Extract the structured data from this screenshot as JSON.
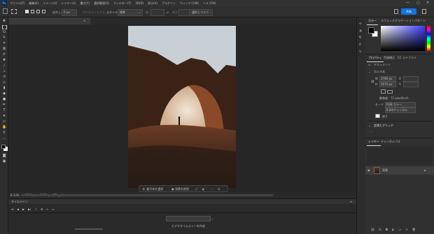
{
  "app": {
    "logo": "Ps",
    "menu": [
      "ファイル(F)",
      "編集(E)",
      "イメージ(I)",
      "レイヤー(L)",
      "書式(Y)",
      "選択範囲(S)",
      "フィルター(T)",
      "3D(D)",
      "表示(V)",
      "プラグイン",
      "ウィンドウ(W)",
      "ヘルプ(H)"
    ],
    "window_controls": [
      "—",
      "▢",
      "✕"
    ]
  },
  "options_bar": {
    "feather_label": "ぼかし:",
    "feather_value": "0 px",
    "antialias_label": "アンチエイリアス",
    "style_label": "スタイル:",
    "style_value": "標準",
    "width_label": "幅:",
    "height_label": "高さ:",
    "select_mask_button": "選択とマスク...",
    "share_button": "共有"
  },
  "document": {
    "tab_title": "nasim-Vibk_m8k-unsplash.jpg @ 8.33% (RGB/8)",
    "tab_close": "×",
    "zoom": "8.33%",
    "doc_size": "3780 px x 5670 px (72 ppi)"
  },
  "context_bar": {
    "select_subject": "被写体を選択",
    "remove_background": "背景を削除"
  },
  "timeline": {
    "title": "タイムライン",
    "create_button": "ビデオタイムラインを作成"
  },
  "color_panel": {
    "tabs": [
      "カラー",
      "スウォッチ",
      "グラデーション",
      "パターン"
    ],
    "fg_color": "#000000",
    "bg_color": "#ffffff"
  },
  "properties_panel": {
    "tabs": [
      "プロパティ",
      "色調補正",
      "CC ライブラリ"
    ],
    "doc_label": "ドキュメント",
    "canvas_section": "カンバス",
    "width_label": "W",
    "width_value": "3780 px",
    "height_label": "H",
    "height_value": "5670 px",
    "x_label": "X",
    "y_label": "Y",
    "resolution_label": "解像度:",
    "resolution_value": "72 pixel/inch",
    "mode_label": "モード",
    "mode_value": "RGB カラー",
    "depth_value": "8 bit/チャンネル",
    "fill_label": "塗り",
    "rulers_section": "定規とグリッド"
  },
  "layers_panel": {
    "tabs": [
      "レイヤー",
      "チャンネル",
      "パス"
    ],
    "layer_name": "背景",
    "lock_icon": "lock-icon"
  },
  "colors": {
    "accent": "#1473e6",
    "panel_bg": "#303030",
    "app_bg": "#232323"
  }
}
